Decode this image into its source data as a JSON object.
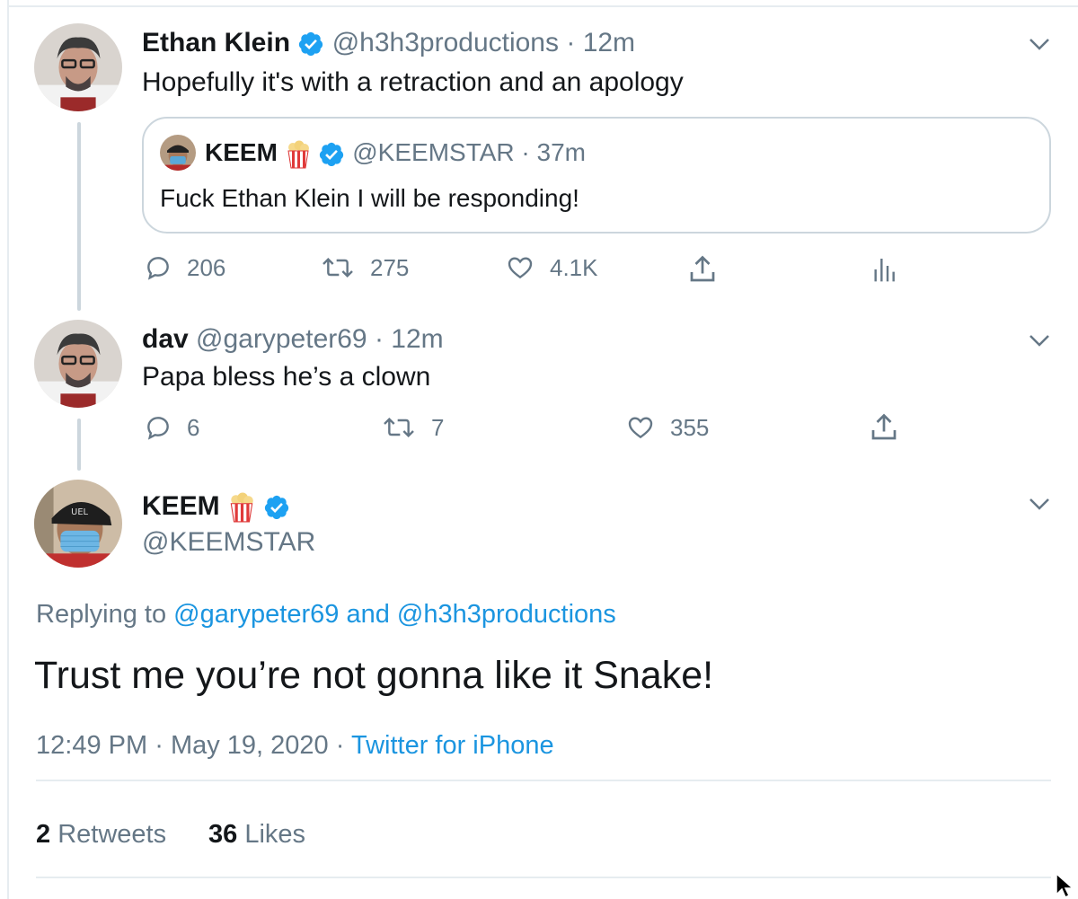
{
  "tweet1": {
    "name": "Ethan Klein",
    "handle": "@h3h3productions",
    "time": "12m",
    "text": "Hopefully it's with a retraction and an apology",
    "quote": {
      "name": "KEEM",
      "handle": "@KEEMSTAR",
      "time": "37m",
      "text": "Fuck Ethan Klein I will be responding!"
    },
    "actions": {
      "replies": "206",
      "retweets": "275",
      "likes": "4.1K"
    }
  },
  "tweet2": {
    "name": "dav",
    "handle": "@garypeter69",
    "time": "12m",
    "text": "Papa bless he’s a clown",
    "actions": {
      "replies": "6",
      "retweets": "7",
      "likes": "355"
    }
  },
  "main_tweet": {
    "name": "KEEM",
    "handle": "@KEEMSTAR",
    "replying_prefix": "Replying to",
    "replying_user1": "@garypeter69",
    "replying_and": "and",
    "replying_user2": "@h3h3productions",
    "text": "Trust me you’re not gonna like it Snake!",
    "time": "12:49 PM",
    "date": "May 19, 2020",
    "source": "Twitter for iPhone",
    "stats": {
      "retweets_count": "2",
      "retweets_label": "Retweets",
      "likes_count": "36",
      "likes_label": "Likes"
    }
  },
  "separator_dot": "·",
  "colors": {
    "link": "#1b95e0",
    "muted": "#657786",
    "text": "#14171a",
    "border": "#ccd6dd"
  },
  "icons": [
    "reply-icon",
    "retweet-icon",
    "like-icon",
    "share-icon",
    "analytics-icon",
    "chevron-down-icon",
    "verified-badge-icon",
    "popcorn-emoji",
    "mouse-cursor-icon"
  ]
}
